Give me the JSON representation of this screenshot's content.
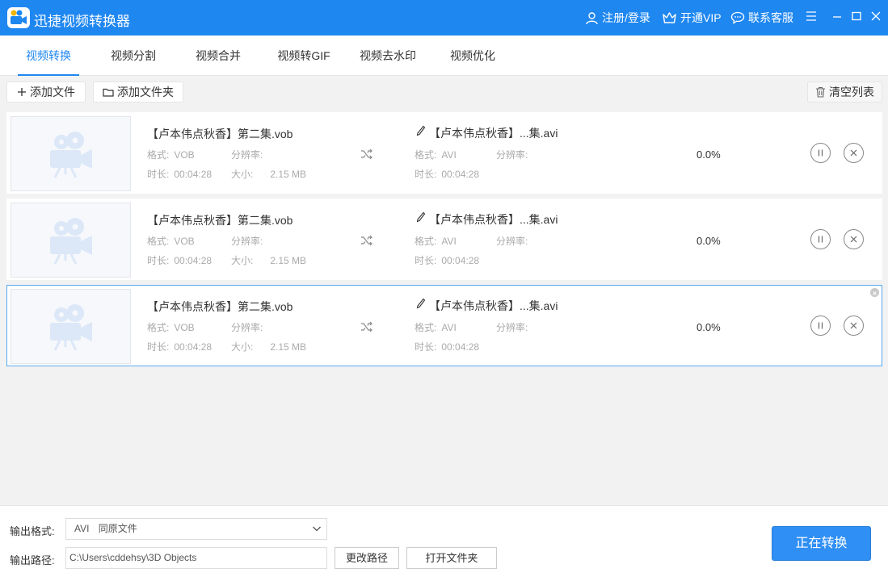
{
  "app": {
    "title": "迅捷视频转换器"
  },
  "titlebar": {
    "login": "注册/登录",
    "vip": "开通VIP",
    "support": "联系客服"
  },
  "tabs": [
    "视频转换",
    "视频分割",
    "视频合并",
    "视频转GIF",
    "视频去水印",
    "视频优化"
  ],
  "toolbar": {
    "add_file": "添加文件",
    "add_folder": "添加文件夹",
    "clear_list": "清空列表"
  },
  "labels": {
    "format": "格式:",
    "resolution": "分辨率:",
    "duration": "时长:",
    "size": "大小:"
  },
  "items": [
    {
      "source_name": "【卢本伟点秋香】第二集.vob",
      "source_format": "VOB",
      "source_duration": "00:04:28",
      "source_size": "2.15 MB",
      "target_name": "【卢本伟点秋香】...集.avi",
      "target_format": "AVI",
      "target_duration": "00:04:28",
      "progress": "0.0%"
    },
    {
      "source_name": "【卢本伟点秋香】第二集.vob",
      "source_format": "VOB",
      "source_duration": "00:04:28",
      "source_size": "2.15 MB",
      "target_name": "【卢本伟点秋香】...集.avi",
      "target_format": "AVI",
      "target_duration": "00:04:28",
      "progress": "0.0%"
    },
    {
      "source_name": "【卢本伟点秋香】第二集.vob",
      "source_format": "VOB",
      "source_duration": "00:04:28",
      "source_size": "2.15 MB",
      "target_name": "【卢本伟点秋香】...集.avi",
      "target_format": "AVI",
      "target_duration": "00:04:28",
      "progress": "0.0%"
    }
  ],
  "bottom": {
    "output_format_label": "输出格式:",
    "output_format_value": "AVI",
    "output_format_quality": "同原文件",
    "output_path_label": "输出路径:",
    "output_path_value": "C:\\Users\\cddehsy\\3D Objects",
    "change_path": "更改路径",
    "open_folder": "打开文件夹",
    "convert": "正在转换"
  },
  "colors": {
    "accent": "#1f87f0",
    "primary_button": "#2f8ff4",
    "selected_border": "#5aa9f5"
  }
}
